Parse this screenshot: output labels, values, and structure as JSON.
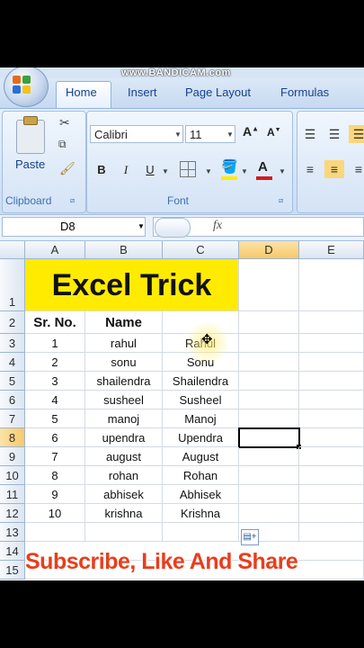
{
  "watermark": "www.BANDICAM.com",
  "tabs": [
    {
      "label": "Home",
      "active": true
    },
    {
      "label": "Insert"
    },
    {
      "label": "Page Layout"
    },
    {
      "label": "Formulas"
    }
  ],
  "ribbon": {
    "clipboard": {
      "paste_label": "Paste",
      "group_label": "Clipboard"
    },
    "font": {
      "font_name": "Calibri",
      "font_size": "11",
      "bold": "B",
      "italic": "I",
      "underline": "U",
      "font_color_letter": "A",
      "group_label": "Font"
    }
  },
  "formula_bar": {
    "name_box": "D8",
    "fx": "fx",
    "value": ""
  },
  "grid": {
    "columns": [
      "A",
      "B",
      "C",
      "D",
      "E"
    ],
    "selected_column": "D",
    "selected_row": "8",
    "rows": [
      "1",
      "2",
      "3",
      "4",
      "5",
      "6",
      "7",
      "8",
      "9",
      "10",
      "11",
      "12",
      "13",
      "14",
      "15"
    ],
    "title": "Excel Trick",
    "headers": {
      "a": "Sr. No.",
      "b": "Name"
    },
    "data": [
      {
        "sr": "1",
        "name": "rahul",
        "proper": "Rahul"
      },
      {
        "sr": "2",
        "name": "sonu",
        "proper": "Sonu"
      },
      {
        "sr": "3",
        "name": "shailendra",
        "proper": "Shailendra"
      },
      {
        "sr": "4",
        "name": "susheel",
        "proper": "Susheel"
      },
      {
        "sr": "5",
        "name": "manoj",
        "proper": "Manoj"
      },
      {
        "sr": "6",
        "name": "upendra",
        "proper": "Upendra"
      },
      {
        "sr": "7",
        "name": "august",
        "proper": "August"
      },
      {
        "sr": "8",
        "name": "rohan",
        "proper": "Rohan"
      },
      {
        "sr": "9",
        "name": "abhisek",
        "proper": "Abhisek"
      },
      {
        "sr": "10",
        "name": "krishna",
        "proper": "Krishna"
      }
    ]
  },
  "caption": "Subscribe, Like And Share",
  "colors": {
    "title_fill": "#ffeb00",
    "caption": "#e83e1c",
    "ribbon_text": "#15428b"
  }
}
